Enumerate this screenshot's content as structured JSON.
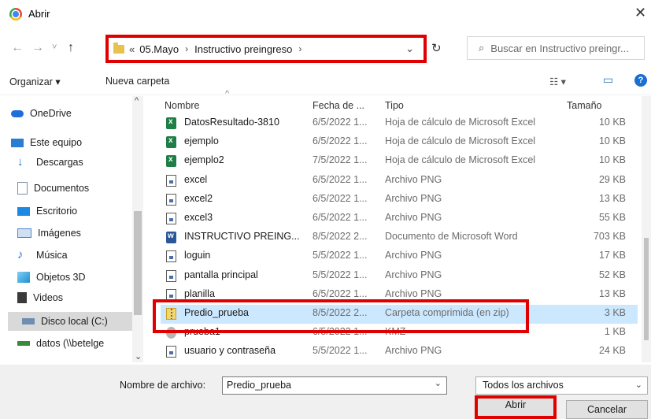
{
  "window": {
    "title": "Abrir",
    "close_glyph": "✕"
  },
  "nav": {
    "back_glyph": "←",
    "forward_glyph": "→",
    "history_glyph": "˅",
    "up_glyph": "↑",
    "breadcrumb_prefix": "«",
    "breadcrumbs": [
      "05.Mayo",
      "Instructivo preingreso"
    ],
    "crumb_separator": "›",
    "dropdown_glyph": "⌄",
    "refresh_glyph": "↻",
    "search_placeholder": "Buscar en Instructivo preingr..."
  },
  "toolbar": {
    "organize_label": "Organizar ▾",
    "new_folder_label": "Nueva carpeta",
    "view_glyph": "☷ ▾",
    "pane_glyph": "▭",
    "help_glyph": "?"
  },
  "sidebar": {
    "items": [
      {
        "label": "OneDrive",
        "icon": "cloud-icon",
        "color": "#1e6fd9"
      },
      {
        "label": "Este equipo",
        "icon": "computer-icon",
        "color": "#2b7cd3"
      },
      {
        "label": "Descargas",
        "icon": "download-icon",
        "color": "#1e6fd9"
      },
      {
        "label": "Documentos",
        "icon": "document-icon",
        "color": "#7a8fa6"
      },
      {
        "label": "Escritorio",
        "icon": "desktop-icon",
        "color": "#1e88e5"
      },
      {
        "label": "Imágenes",
        "icon": "images-icon",
        "color": "#4b88c8"
      },
      {
        "label": "Música",
        "icon": "music-icon",
        "color": "#1e6fd9"
      },
      {
        "label": "Objetos 3D",
        "icon": "cube-icon",
        "color": "#2aa0d8"
      },
      {
        "label": "Videos",
        "icon": "video-icon",
        "color": "#3a3a3a"
      },
      {
        "label": "Disco local (C:)",
        "icon": "drive-icon",
        "color": "#6f8fb0"
      },
      {
        "label": "datos (\\\\betelge",
        "icon": "network-drive-icon",
        "color": "#3a8a3a"
      }
    ],
    "scroll_up_glyph": "^",
    "scroll_down_glyph": "⌄"
  },
  "filelist": {
    "headers": {
      "name": "Nombre",
      "date": "Fecha de ...",
      "type": "Tipo",
      "size": "Tamaño"
    },
    "sort_glyph": "^",
    "rows": [
      {
        "name": "DatosResultado-3810",
        "date": "6/5/2022 1...",
        "type": "Hoja de cálculo de Microsoft Excel",
        "size": "10 KB",
        "icon": "xls"
      },
      {
        "name": "ejemplo",
        "date": "6/5/2022 1...",
        "type": "Hoja de cálculo de Microsoft Excel",
        "size": "10 KB",
        "icon": "xls"
      },
      {
        "name": "ejemplo2",
        "date": "7/5/2022 1...",
        "type": "Hoja de cálculo de Microsoft Excel",
        "size": "10 KB",
        "icon": "xls"
      },
      {
        "name": "excel",
        "date": "6/5/2022 1...",
        "type": "Archivo PNG",
        "size": "29 KB",
        "icon": "png"
      },
      {
        "name": "excel2",
        "date": "6/5/2022 1...",
        "type": "Archivo PNG",
        "size": "13 KB",
        "icon": "png"
      },
      {
        "name": "excel3",
        "date": "6/5/2022 1...",
        "type": "Archivo PNG",
        "size": "55 KB",
        "icon": "png"
      },
      {
        "name": "INSTRUCTIVO PREING...",
        "date": "8/5/2022 2...",
        "type": "Documento de Microsoft Word",
        "size": "703 KB",
        "icon": "doc"
      },
      {
        "name": "loguin",
        "date": "5/5/2022 1...",
        "type": "Archivo PNG",
        "size": "17 KB",
        "icon": "png"
      },
      {
        "name": "pantalla principal",
        "date": "5/5/2022 1...",
        "type": "Archivo PNG",
        "size": "52 KB",
        "icon": "png"
      },
      {
        "name": "planilla",
        "date": "6/5/2022 1...",
        "type": "Archivo PNG",
        "size": "13 KB",
        "icon": "png"
      },
      {
        "name": "Predio_prueba",
        "date": "8/5/2022 2...",
        "type": "Carpeta comprimida (en zip)",
        "size": "3 KB",
        "icon": "zip",
        "selected": true
      },
      {
        "name": "prueba1",
        "date": "6/5/2022 1...",
        "type": "KMZ",
        "size": "1 KB",
        "icon": "kmz"
      },
      {
        "name": "usuario y contraseña",
        "date": "5/5/2022 1...",
        "type": "Archivo PNG",
        "size": "24 KB",
        "icon": "png"
      }
    ]
  },
  "bottom": {
    "filename_label": "Nombre de archivo:",
    "filename_value": "Predio_prueba",
    "filter_value": "Todos los archivos",
    "dropdown_glyph": "⌄",
    "open_label": "Abrir",
    "cancel_label": "Cancelar"
  },
  "colors": {
    "highlight": "#e00000",
    "selection": "#cce8ff",
    "accent": "#1a6fd4"
  }
}
